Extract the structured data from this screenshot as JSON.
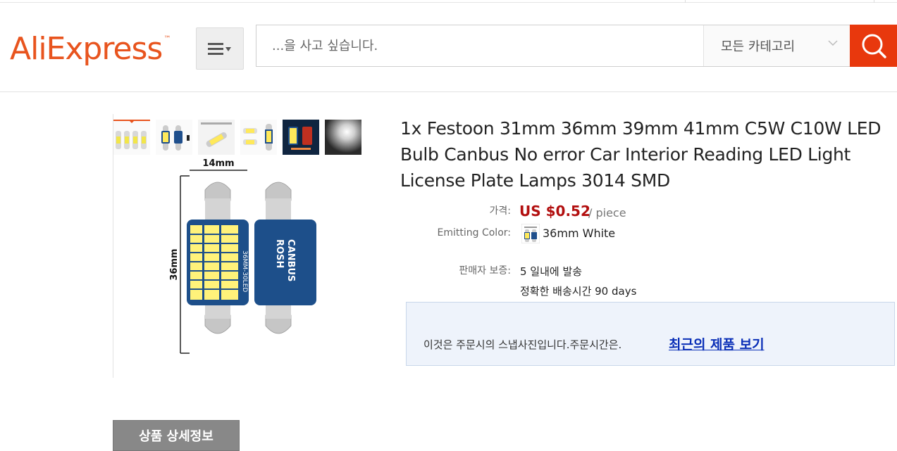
{
  "header": {
    "logo_text": "AliExpress",
    "logo_tm": "™",
    "search_placeholder": "...을 사고 싶습니다.",
    "category_label": "모든 카테고리"
  },
  "product": {
    "title": "1x Festoon 31mm 36mm 39mm 41mm C5W C10W LED Bulb Canbus No error Car Interior Reading LED Light License Plate Lamps 3014 SMD",
    "price_label": "가격:",
    "price": "US $0.52",
    "price_unit": "/ piece",
    "color_label": "Emitting Color:",
    "color_value": "36mm White",
    "seller_label": "판매자 보증:",
    "ship_days": "5 일내에 발송",
    "delivery_time": "정확한 배송시간 90 days"
  },
  "image_labels": {
    "width": "14mm",
    "height": "36mm",
    "led_marking": "36MM-30LED",
    "canbus": "CANBUS",
    "rosh": "ROSH"
  },
  "notice": {
    "text": "이것은 주문시의 스냅사진입니다.주문시간은.",
    "link": "최근의 제품 보기"
  },
  "tabs": {
    "detail": "상품 상세정보"
  },
  "colors": {
    "brand_orange": "#e8541e",
    "search_button": "#e8380d",
    "price_red": "#b20f0f",
    "link_blue": "#0a2fb7",
    "notice_bg": "#eef3fb"
  }
}
